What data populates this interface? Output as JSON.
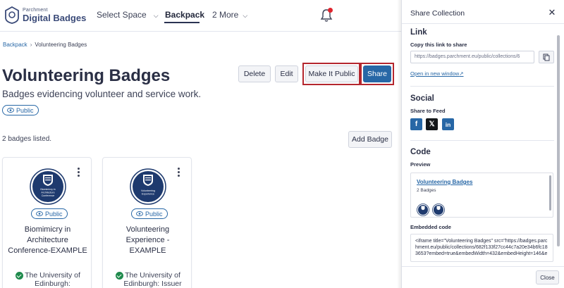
{
  "logo": {
    "small": "Parchment",
    "big": "Digital Badges"
  },
  "nav": {
    "select_space": "Select Space",
    "backpack": "Backpack",
    "more": "2 More"
  },
  "breadcrumb": {
    "root": "Backpack",
    "current": "Volunteering Badges"
  },
  "collection": {
    "title": "Volunteering Badges",
    "description": "Badges evidencing volunteer and service work.",
    "visibility": "Public"
  },
  "toolbar": {
    "delete": "Delete",
    "edit": "Edit",
    "make_public": "Make It Public",
    "share": "Share"
  },
  "list": {
    "count_text": "2 badges listed.",
    "add_badge": "Add Badge"
  },
  "badges": [
    {
      "visibility": "Public",
      "image_text": "Biomimicry in Architecture Conference",
      "name": "Biomimicry in Architecture Conference-EXAMPLE",
      "issuer": "The University of Edinburgh:"
    },
    {
      "visibility": "Public",
      "image_text": "Volunteering Experience",
      "name": "Volunteering Experience - EXAMPLE",
      "issuer": "The University of Edinburgh: Issuer Example"
    }
  ],
  "share_panel": {
    "title": "Share Collection",
    "link": {
      "heading": "Link",
      "sub": "Copy this link to share",
      "url": "https://badges.parchment.eu/public/collections/6",
      "open_new": "Open in new window"
    },
    "social": {
      "heading": "Social",
      "sub": "Share to Feed"
    },
    "code": {
      "heading": "Code",
      "preview_label": "Preview",
      "preview_title": "Volunteering Badges",
      "preview_count": "2 Badges",
      "embed_label": "Embedded code",
      "embed_code": "<iframe title=\"Volunteering Badges\" src=\"https://badges.parchment.eu/public/collections/682f133f27cc44c7a20e34b6fc183653?embed=true&embedWidth=432&embedHeight=146&e"
    },
    "close": "Close"
  },
  "colors": {
    "accent": "#2767a6",
    "highlight": "#b4262e",
    "verified": "#1f8a4c",
    "notification": "#e0242d"
  }
}
